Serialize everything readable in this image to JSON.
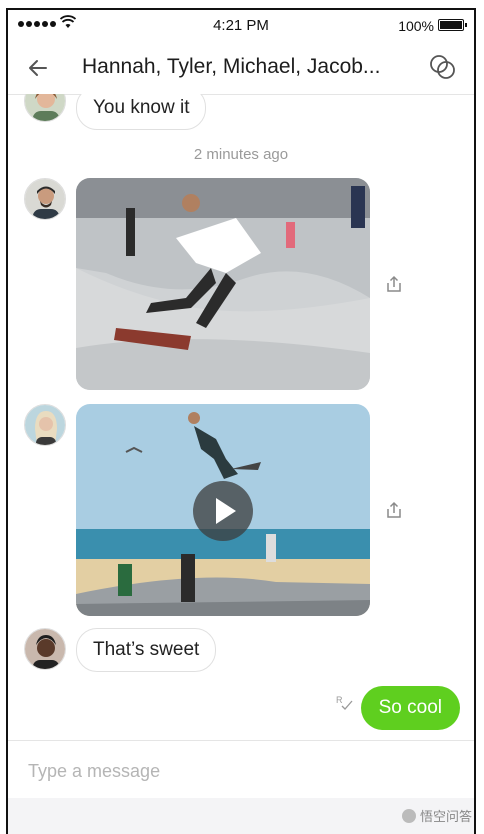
{
  "status_bar": {
    "time": "4:21 PM",
    "battery": "100%",
    "signal_icon": "signal-dots-icon",
    "wifi_icon": "wifi-icon",
    "battery_level": 1.0
  },
  "header": {
    "title": "Hannah, Tyler, Michael, Jacob...",
    "back_icon": "back-arrow-icon",
    "group_icon": "group-circles-icon"
  },
  "messages": [
    {
      "type": "text",
      "direction": "incoming",
      "text": "You know it"
    },
    {
      "type": "timestamp",
      "text": "2 minutes ago"
    },
    {
      "type": "photo",
      "direction": "incoming",
      "content": "skateboarder in skatepark"
    },
    {
      "type": "video",
      "direction": "incoming",
      "content": "skateboarder at beach",
      "play_icon": "play-icon"
    },
    {
      "type": "text",
      "direction": "incoming",
      "text": "That’s sweet"
    },
    {
      "type": "text",
      "direction": "outgoing",
      "text": "So cool",
      "receipt": "R"
    }
  ],
  "composer": {
    "placeholder": "Type a message"
  },
  "colors": {
    "accent": "#5fcf1f",
    "border": "#e0e0e0",
    "muted": "#9a9a9a"
  }
}
